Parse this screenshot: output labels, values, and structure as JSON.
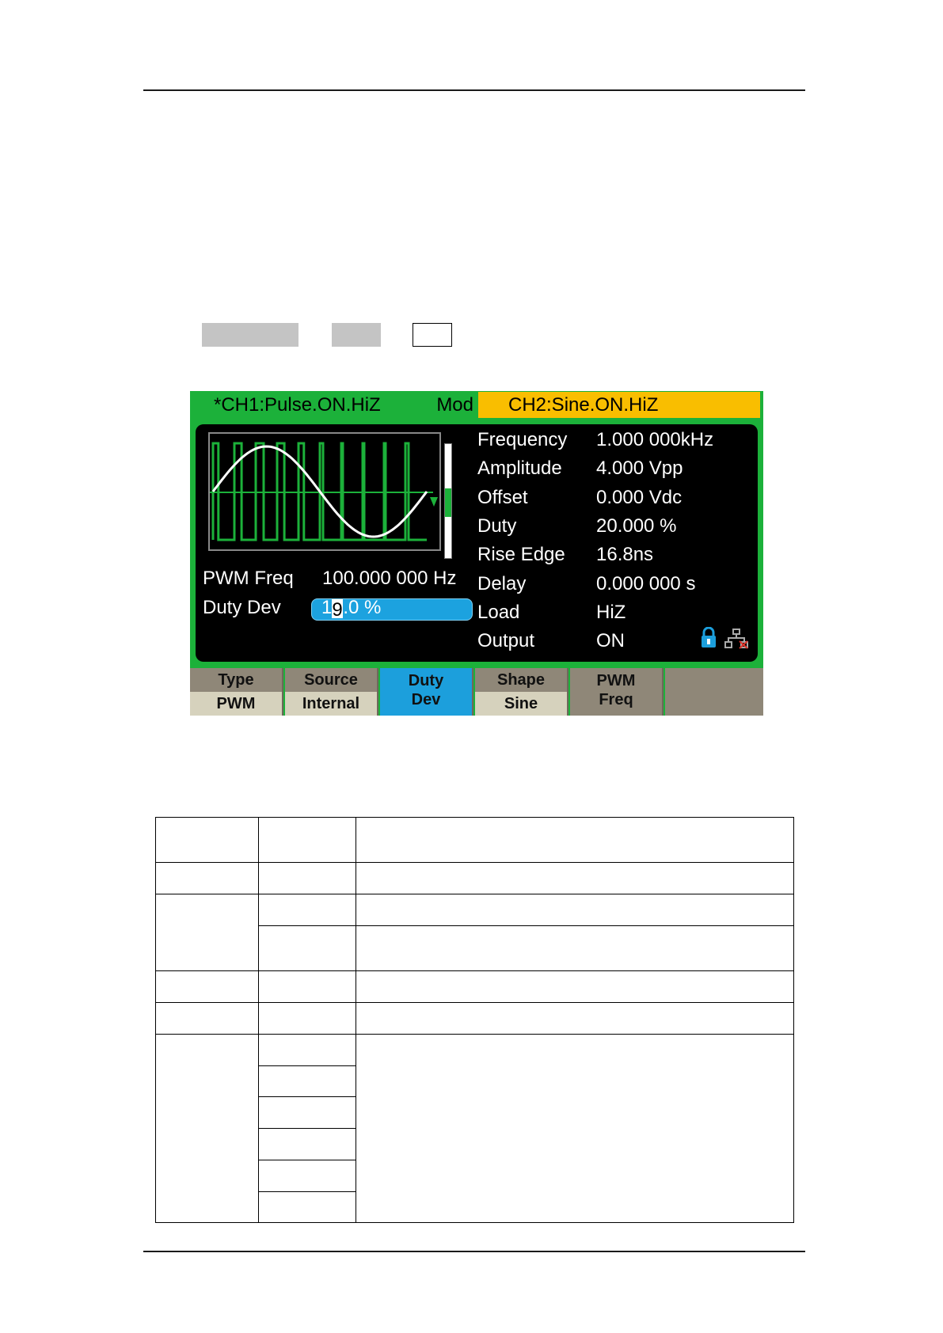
{
  "screen": {
    "ch1_tab": "*CH1:Pulse.ON.HiZ",
    "mod_label": "Mod",
    "ch2_tab": "CH2:Sine.ON.HiZ",
    "params": [
      {
        "label": "Frequency",
        "value": "1.000 000kHz"
      },
      {
        "label": "Amplitude",
        "value": "4.000 Vpp"
      },
      {
        "label": "Offset",
        "value": "0.000 Vdc"
      },
      {
        "label": "Duty",
        "value": "20.000 %"
      },
      {
        "label": "Rise Edge",
        "value": "16.8ns"
      },
      {
        "label": "Delay",
        "value": "0.000 000 s"
      },
      {
        "label": "Load",
        "value": "HiZ"
      },
      {
        "label": "Output",
        "value": "ON"
      }
    ],
    "pwm_freq": {
      "label": "PWM Freq",
      "value": "100.000 000 Hz"
    },
    "duty_dev": {
      "label": "Duty Dev",
      "value_prefix": "1",
      "value_cursor": "9",
      "value_suffix": ".0 %"
    },
    "icons": {
      "lock": "lock-icon",
      "network": "network-icon"
    },
    "colors": {
      "frame": "#1cb13a",
      "ch2_tab": "#f9be00",
      "active_softkey": "#1c9fdc",
      "softkey": "#8f8778",
      "softkey_value": "#d6d2bd"
    }
  },
  "softkeys": [
    {
      "top": "Type",
      "bottom": "PWM"
    },
    {
      "top": "Source",
      "bottom": "Internal"
    },
    {
      "line1": "Duty",
      "line2": "Dev"
    },
    {
      "top": "Shape",
      "bottom": "Sine"
    },
    {
      "line1": "PWM",
      "line2": "Freq"
    }
  ]
}
